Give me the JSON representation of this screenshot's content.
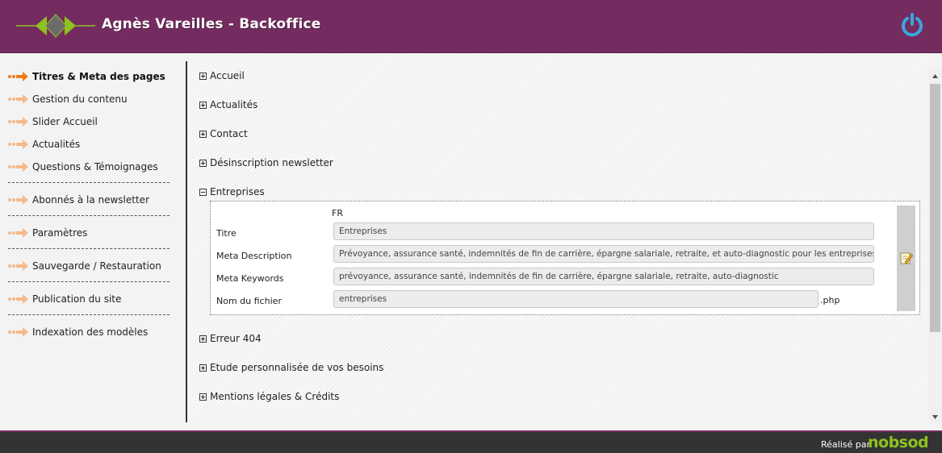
{
  "header": {
    "title": "Agnès Vareilles - Backoffice",
    "icons": {
      "logo": "diamond-arrows-logo",
      "power": "power-icon"
    },
    "colors": {
      "header_bg": "#742c60",
      "logo_green": "#8dc21f",
      "power_blue": "#3aa6e0"
    }
  },
  "sidebar": {
    "items": [
      {
        "label": "Titres & Meta des pages",
        "active": true
      },
      {
        "label": "Gestion du contenu"
      },
      {
        "label": "Slider Accueil"
      },
      {
        "label": "Actualités"
      },
      {
        "label": "Questions & Témoignages"
      },
      {
        "label": "Abonnés à la newsletter"
      },
      {
        "label": "Paramètres"
      },
      {
        "label": "Sauvegarde / Restauration"
      },
      {
        "label": "Publication du site"
      },
      {
        "label": "Indexation des modèles"
      }
    ],
    "icon": "orange-arrow-icon"
  },
  "main": {
    "pages": [
      {
        "label": "Accueil",
        "expanded": false
      },
      {
        "label": "Actualités",
        "expanded": false
      },
      {
        "label": "Contact",
        "expanded": false
      },
      {
        "label": "Désinscription newsletter",
        "expanded": false
      },
      {
        "label": "Entreprises",
        "expanded": true
      },
      {
        "label": "Erreur 404",
        "expanded": false
      },
      {
        "label": "Etude personnalisée de vos besoins",
        "expanded": false
      },
      {
        "label": "Mentions légales & Crédits",
        "expanded": false
      }
    ],
    "detail": {
      "lang": "FR",
      "titre_label": "Titre",
      "titre_value": "Entreprises",
      "meta_description_label": "Meta Description",
      "meta_description_value": "Prévoyance, assurance santé, indemnités de fin de carrière, épargne salariale, retraite, et auto-diagnostic pour les entreprises.",
      "meta_keywords_label": "Meta Keywords",
      "meta_keywords_value": "prévoyance, assurance santé, indemnités de fin de carrière, épargne salariale, retraite, auto-diagnostic",
      "filename_label": "Nom du fichier",
      "filename_value": "entreprises",
      "filename_ext": ".php",
      "edit_icon": "edit-icon"
    }
  },
  "footer": {
    "credit": "Réalisé par",
    "brand": "nobsod"
  }
}
